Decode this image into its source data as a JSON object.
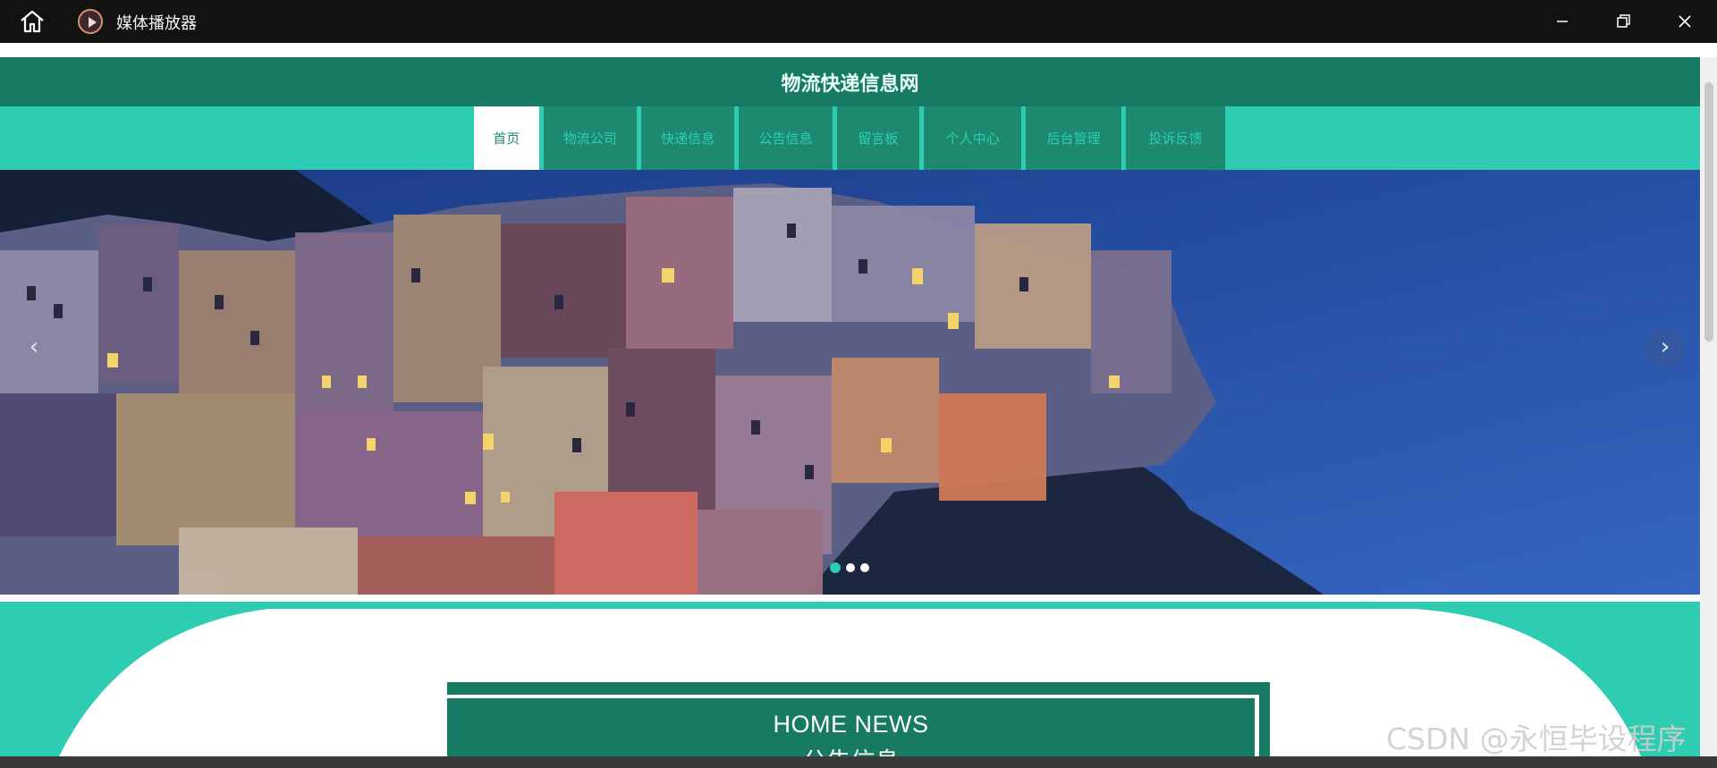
{
  "player": {
    "title": "媒体播放器",
    "icons": [
      "home-icon",
      "media-player-app-icon",
      "minimize-icon",
      "restore-icon",
      "close-icon"
    ]
  },
  "site": {
    "title": "物流快递信息网",
    "nav": [
      {
        "label": "首页",
        "active": true
      },
      {
        "label": "物流公司"
      },
      {
        "label": "快递信息"
      },
      {
        "label": "公告信息"
      },
      {
        "label": "留言板"
      },
      {
        "label": "个人中心"
      },
      {
        "label": "后台管理"
      },
      {
        "label": "投诉反馈"
      }
    ]
  },
  "carousel": {
    "prev_icon": "‹",
    "next_icon": "›",
    "slide_count": 3,
    "active_index": 0
  },
  "news": {
    "title_en": "HOME NEWS",
    "title_zh": "公告信息"
  },
  "watermark": "CSDN @永恒毕设程序",
  "colors": {
    "header_dark_green": "#177a63",
    "nav_teal": "#2ecdb2",
    "nav_item_green": "#1d8a70",
    "player_titlebar": "#121212"
  }
}
